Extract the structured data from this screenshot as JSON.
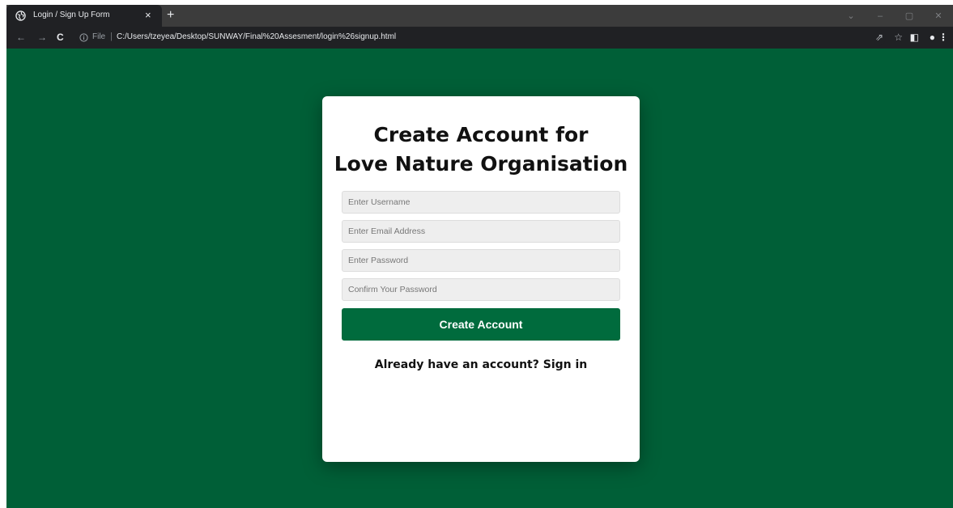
{
  "browser": {
    "tab_title": "Login / Sign Up Form",
    "tab_close": "×",
    "new_tab": "+",
    "nav": {
      "back": "←",
      "forward": "→",
      "reload": "C"
    },
    "address": {
      "scheme_label": "File",
      "separator": "|",
      "url": "C:/Users/tzeyea/Desktop/SUNWAY/Final%20Assesment/login%26signup.html"
    },
    "window_controls": {
      "tab_search": "⌄",
      "minimize": "–",
      "maximize": "▢",
      "close": "✕"
    },
    "toolbar_icons": {
      "share": "⇗",
      "bookmark": "☆",
      "side_panel": "◧",
      "profile": "●",
      "menu": "⋮"
    }
  },
  "form": {
    "title_line1": "Create Account for",
    "title_line2": "Love Nature Organisation",
    "fields": {
      "username_placeholder": "Enter Username",
      "email_placeholder": "Enter Email Address",
      "password_placeholder": "Enter Password",
      "confirm_placeholder": "Confirm Your Password"
    },
    "submit_label": "Create Account",
    "signin_prompt": "Already have an account?",
    "signin_link": "Sign in"
  },
  "colors": {
    "page_background": "#005f37",
    "button": "#006b3d",
    "card": "#ffffff",
    "field_background": "#eeeeee"
  }
}
